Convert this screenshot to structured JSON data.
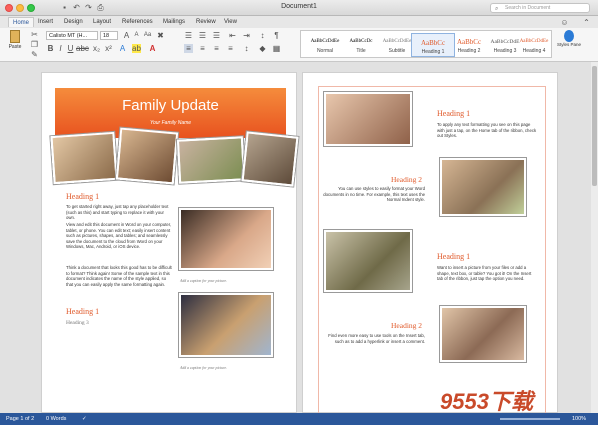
{
  "window": {
    "title": "Document1",
    "search_placeholder": "Search in Document"
  },
  "tabs": [
    "Home",
    "Insert",
    "Design",
    "Layout",
    "References",
    "Mailings",
    "Review",
    "View"
  ],
  "ribbon": {
    "paste_label": "Paste",
    "font_name": "Calisto MT (H...",
    "font_size": "18",
    "styles": [
      {
        "preview": "AaBbCcDdEe",
        "name": "Normal"
      },
      {
        "preview": "AaBbCcDc",
        "name": "Title"
      },
      {
        "preview": "AaBbCcDdEe",
        "name": "Subtitle"
      },
      {
        "preview": "AaBbCc",
        "name": "Heading 1"
      },
      {
        "preview": "AaBbCc",
        "name": "Heading 2"
      },
      {
        "preview": "AaBbCcDdE",
        "name": "Heading 3"
      },
      {
        "preview": "AaBbCcDdEe",
        "name": "Heading 4"
      }
    ],
    "styles_pane_label": "Styles Pane"
  },
  "page1": {
    "banner_title": "Family Update",
    "banner_subtitle": "Your Family Name",
    "heading1": "Heading 1",
    "para1": "To get started right away, just tap any placeholder text (such as this) and start typing to replace it with your own.",
    "para2": "View and edit this document in Word on your computer, tablet, or phone. You can edit text; easily insert content such as pictures, shapes, and tables; and seamlessly save the document to the cloud from Word on your Windows, Mac, Android, or iOS device.",
    "para3": "Think a document that looks this good has to be difficult to format? Think again! Some of the sample text in this document indicates the name of the style applied, so that you can easily apply the same formatting again.",
    "heading1b": "Heading 1",
    "heading3": "Heading 3",
    "caption1": "Add a caption for your picture.",
    "caption2": "Add a caption for your picture."
  },
  "page2": {
    "h1a": "Heading 1",
    "p1": "To apply any text formatting you see on this page with just a tap, on the Home tab of the ribbon, check out Styles.",
    "h2a": "Heading 2",
    "p2": "You can use styles to easily format your Word documents in no time. For example, this text uses the Normal Indent style.",
    "h1b": "Heading 1",
    "p3": "Want to insert a picture from your files or add a shape, text box, or table? You got it! On the Insert tab of the ribbon, just tap the option you need.",
    "h2b": "Heading 2",
    "p4": "Find even more easy to use tools on the Insert tab, such as to add a hyperlink or insert a comment."
  },
  "status": {
    "page": "Page 1 of 2",
    "words": "0 Words",
    "zoom": "100%"
  },
  "watermark": "9553下载"
}
